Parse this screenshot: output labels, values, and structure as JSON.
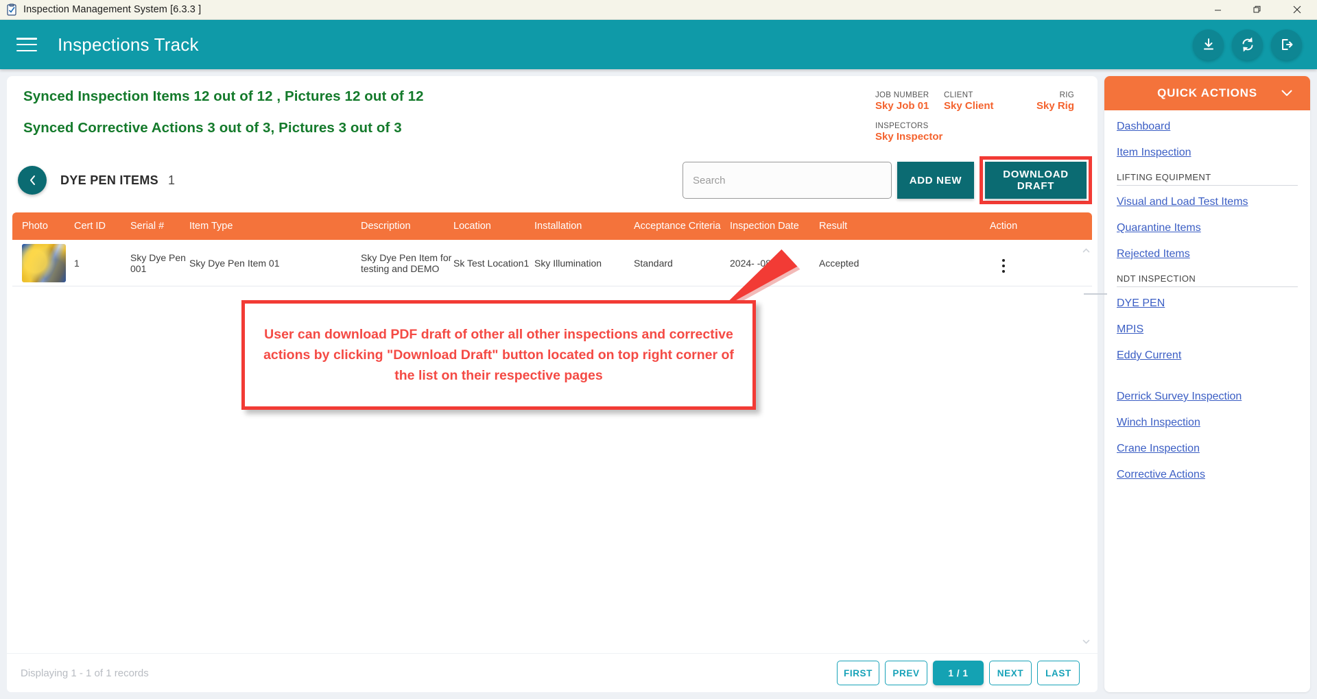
{
  "window": {
    "title": "Inspection Management System [6.3.3 ]",
    "app_icon": "clipboard-check-icon",
    "minimize_label": "—",
    "maximize_label": "❐",
    "close_label": "✕"
  },
  "appbar": {
    "menu_icon": "hamburger-menu-icon",
    "title": "Inspections Track",
    "actions": [
      {
        "name": "download-icon",
        "label": "Download"
      },
      {
        "name": "sync-icon",
        "label": "Sync"
      },
      {
        "name": "logout-icon",
        "label": "Logout"
      }
    ]
  },
  "sync": {
    "inspection_items_line": "Synced Inspection Items 12 out of 12 , Pictures 12 out of 12",
    "corrective_actions_line": "Synced Corrective Actions 3 out of 3, Pictures 3 out of 3",
    "color": "#147a2b"
  },
  "job_info": {
    "job_number_label": "JOB NUMBER",
    "job_number_value": "Sky Job 01",
    "client_label": "CLIENT",
    "client_value": "Sky Client",
    "rig_label": "RIG",
    "rig_value": "Sky Rig",
    "inspectors_label": "INSPECTORS",
    "inspectors_value": "Sky Inspector",
    "value_color": "#f4622d"
  },
  "toolbar": {
    "back_icon": "chevron-left-icon",
    "list_title": "DYE PEN ITEMS",
    "list_count": "1",
    "search_placeholder": "Search",
    "search_value": "",
    "add_new_label": "ADD NEW",
    "download_draft_label": "DOWNLOAD DRAFT",
    "highlight_color": "#f23b35"
  },
  "table": {
    "columns": [
      "Photo",
      "Cert ID",
      "Serial #",
      "Item Type",
      "Description",
      "Location",
      "Installation",
      "Acceptance Criteria",
      "Inspection Date",
      "Result",
      "Action"
    ],
    "rows": [
      {
        "photo": "item-thumbnail",
        "cert_id": "1",
        "serial": "Sky Dye Pen 001",
        "item_type": "Sky Dye Pen Item 01",
        "description": "Sky Dye Pen Item for testing and DEMO",
        "location": "Sk Test Location1",
        "installation": "Sky Illumination",
        "acceptance_criteria": "Standard",
        "inspection_date": "2024-  -08",
        "result": "Accepted",
        "action_icon": "kebab-menu-icon"
      }
    ],
    "header_bg": "#f4733b"
  },
  "annotation": {
    "text": "User can download PDF draft of other all other inspections and corrective actions by clicking \"Download Draft\" button located on top right corner of the list on their respective pages",
    "color": "#f44a44",
    "arrow": "red-arrow-pointer"
  },
  "footer": {
    "records_text": "Displaying 1 - 1 of 1 records",
    "pager": {
      "first": "FIRST",
      "prev": "PREV",
      "current": "1  /  1",
      "next": "NEXT",
      "last": "LAST"
    }
  },
  "quick_actions": {
    "header": "QUICK ACTIONS",
    "chevron_icon": "chevron-down-icon",
    "top_links": [
      {
        "label": "Dashboard"
      },
      {
        "label": "Item Inspection"
      }
    ],
    "lifting_section": "LIFTING EQUIPMENT",
    "lifting_links": [
      {
        "label": "Visual and Load Test Items"
      },
      {
        "label": "Quarantine Items"
      },
      {
        "label": "Rejected Items"
      }
    ],
    "ndt_section": "NDT INSPECTION",
    "ndt_links": [
      {
        "label": "DYE PEN"
      },
      {
        "label": "MPIS"
      },
      {
        "label": "Eddy Current"
      }
    ],
    "other_links": [
      {
        "label": "Derrick Survey Inspection"
      },
      {
        "label": "Winch Inspection"
      },
      {
        "label": "Crane Inspection"
      },
      {
        "label": "Corrective Actions"
      }
    ]
  },
  "scroll": {
    "up_icon": "scroll-up-arrow",
    "down_icon": "scroll-down-arrow"
  }
}
